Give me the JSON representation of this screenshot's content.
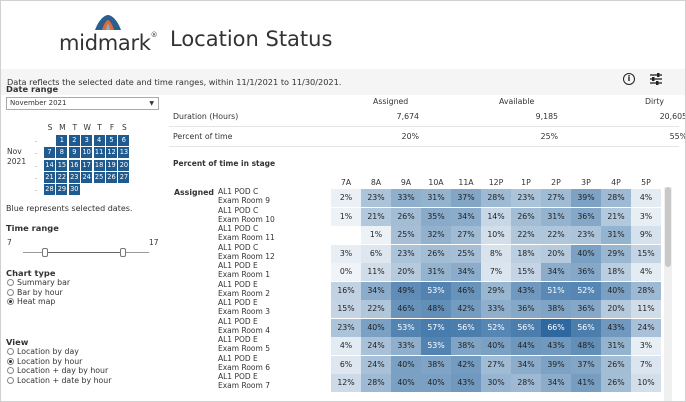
{
  "brand": {
    "logo_text": "midmark",
    "logo_reg": "®"
  },
  "page_title": "Location Status",
  "info_text": "Data reflects the selected date and time ranges, within 11/1/2021 to 11/30/2021.",
  "icons": {
    "info": "info-circle-icon",
    "filter": "sliders-icon"
  },
  "sidebar": {
    "date_range_label": "Date range",
    "month_select": "November 2021",
    "calendar": {
      "weekdays": [
        "S",
        "M",
        "T",
        "W",
        "T",
        "F",
        "S"
      ],
      "month_label_1": "Nov",
      "month_label_2": "2021",
      "weeks": [
        [
          "",
          "1",
          "2",
          "3",
          "4",
          "5",
          "6"
        ],
        [
          "7",
          "8",
          "9",
          "10",
          "11",
          "12",
          "13"
        ],
        [
          "14",
          "15",
          "16",
          "17",
          "18",
          "19",
          "20"
        ],
        [
          "21",
          "22",
          "23",
          "24",
          "25",
          "26",
          "27"
        ],
        [
          "28",
          "29",
          "30",
          "",
          "",
          "",
          ""
        ]
      ]
    },
    "note": "Blue represents selected dates.",
    "time_range_label": "Time range",
    "time_min": "7",
    "time_max": "17",
    "chart_type_label": "Chart type",
    "chart_types": [
      "Summary bar",
      "Bar by hour",
      "Heat map"
    ],
    "chart_type_selected": 2,
    "view_label": "View",
    "views": [
      "Location by day",
      "Location by hour",
      "Location + day by hour",
      "Location + date by hour"
    ],
    "view_selected": 1
  },
  "summary": {
    "columns": [
      "Assigned",
      "Available",
      "Dirty"
    ],
    "rows": [
      {
        "label": "Duration (Hours)",
        "values": [
          "7,674",
          "9,185",
          "20,605"
        ]
      },
      {
        "label": "Percent of time",
        "values": [
          "20%",
          "25%",
          "55%"
        ]
      }
    ]
  },
  "stage_title": "Percent of time in stage",
  "heatmap": {
    "group": "Assigned",
    "hours": [
      "7A",
      "8A",
      "9A",
      "10A",
      "11A",
      "12P",
      "1P",
      "2P",
      "3P",
      "4P",
      "5P"
    ],
    "rows": [
      {
        "line1": "AL1 POD C",
        "line2": "Exam Room 9",
        "values": [
          2,
          23,
          33,
          31,
          37,
          28,
          23,
          27,
          39,
          28,
          4
        ]
      },
      {
        "line1": "AL1 POD C",
        "line2": "Exam Room 10",
        "values": [
          1,
          21,
          26,
          35,
          34,
          14,
          26,
          31,
          36,
          21,
          3
        ]
      },
      {
        "line1": "AL1 POD C",
        "line2": "Exam Room 11",
        "values": [
          null,
          1,
          25,
          32,
          27,
          10,
          22,
          22,
          23,
          31,
          9
        ]
      },
      {
        "line1": "AL1 POD C",
        "line2": "Exam Room 12",
        "values": [
          3,
          6,
          23,
          26,
          25,
          8,
          18,
          20,
          40,
          29,
          15
        ]
      },
      {
        "line1": "AL1 POD E",
        "line2": "Exam Room 1",
        "values": [
          0,
          11,
          20,
          31,
          34,
          7,
          15,
          34,
          36,
          18,
          4
        ]
      },
      {
        "line1": "AL1 POD E",
        "line2": "Exam Room 2",
        "values": [
          16,
          34,
          49,
          53,
          46,
          29,
          43,
          51,
          52,
          40,
          28
        ]
      },
      {
        "line1": "AL1 POD E",
        "line2": "Exam Room 3",
        "values": [
          15,
          22,
          46,
          48,
          42,
          33,
          36,
          38,
          36,
          20,
          11
        ]
      },
      {
        "line1": "AL1 POD E",
        "line2": "Exam Room 4",
        "values": [
          23,
          40,
          53,
          57,
          56,
          52,
          56,
          66,
          56,
          43,
          24
        ]
      },
      {
        "line1": "AL1 POD E",
        "line2": "Exam Room 5",
        "values": [
          4,
          24,
          33,
          53,
          38,
          40,
          44,
          43,
          48,
          31,
          3
        ]
      },
      {
        "line1": "AL1 POD E",
        "line2": "Exam Room 6",
        "values": [
          6,
          24,
          40,
          38,
          42,
          27,
          34,
          39,
          37,
          26,
          7
        ]
      },
      {
        "line1": "AL1 POD E",
        "line2": "Exam Room 7",
        "values": [
          12,
          28,
          40,
          40,
          43,
          30,
          28,
          34,
          41,
          26,
          10
        ]
      }
    ]
  }
}
